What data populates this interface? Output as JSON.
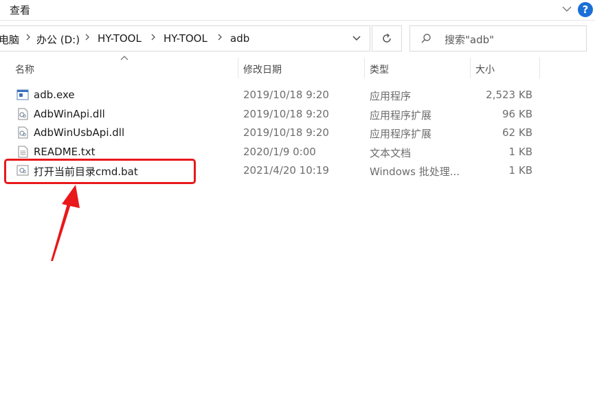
{
  "ribbon": {
    "tab_label": "查看",
    "help_label": "?"
  },
  "address_bar": {
    "crumbs": [
      "电脑",
      "办公 (D:)",
      "HY-TOOL",
      "HY-TOOL",
      "adb"
    ]
  },
  "search": {
    "placeholder": "搜索\"adb\""
  },
  "columns": {
    "name": "名称",
    "modified": "修改日期",
    "type": "类型",
    "size": "大小"
  },
  "files": [
    {
      "name": "adb.exe",
      "modified": "2019/10/18 9:20",
      "type": "应用程序",
      "size": "2,523 KB",
      "icon": "exe-file-icon"
    },
    {
      "name": "AdbWinApi.dll",
      "modified": "2019/10/18 9:20",
      "type": "应用程序扩展",
      "size": "96 KB",
      "icon": "dll-file-icon"
    },
    {
      "name": "AdbWinUsbApi.dll",
      "modified": "2019/10/18 9:20",
      "type": "应用程序扩展",
      "size": "62 KB",
      "icon": "dll-file-icon"
    },
    {
      "name": "README.txt",
      "modified": "2020/1/9 0:00",
      "type": "文本文档",
      "size": "1 KB",
      "icon": "text-file-icon"
    },
    {
      "name": "打开当前目录cmd.bat",
      "modified": "2021/4/20 10:19",
      "type": "Windows 批处理...",
      "size": "1 KB",
      "icon": "batch-file-icon"
    }
  ],
  "colors": {
    "highlight": "#e8181b",
    "help": "#1a6fd6"
  }
}
